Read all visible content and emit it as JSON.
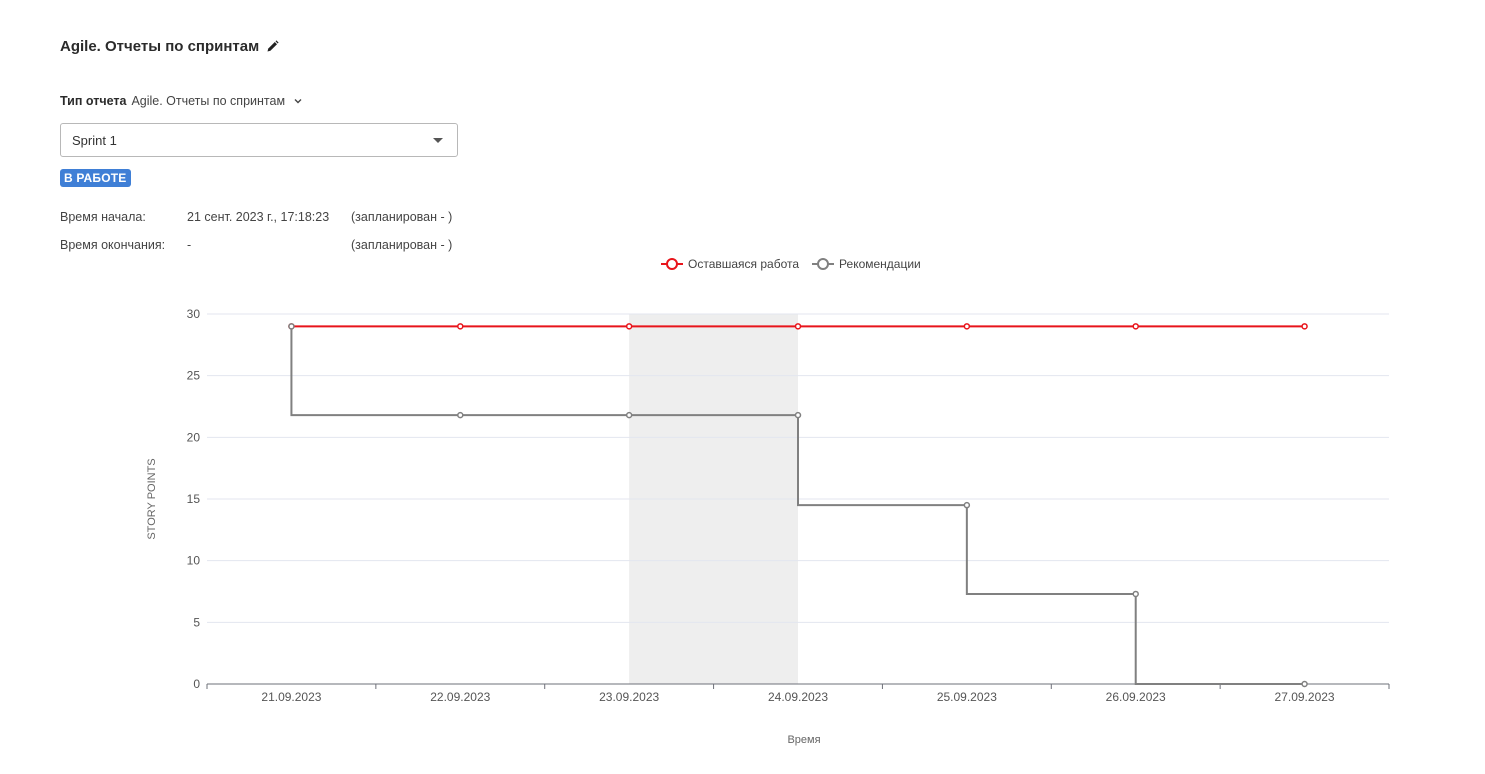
{
  "header": {
    "title": "Agile. Отчеты по спринтам"
  },
  "report_type": {
    "label": "Тип отчета",
    "value": "Agile. Отчеты по спринтам"
  },
  "sprint_select": {
    "value": "Sprint 1"
  },
  "status_badge": "В РАБОТЕ",
  "timing": {
    "start_label": "Время начала:",
    "start_value": "21 сент. 2023 г., 17:18:23",
    "start_planned": "(запланирован - )",
    "end_label": "Время окончания:",
    "end_value": "-",
    "end_planned": "(запланирован - )"
  },
  "colors": {
    "remaining": "#e8141b",
    "recommend": "#808080",
    "weekend_band": "#eeeeee",
    "badge": "#3f7fd6"
  },
  "chart_data": {
    "type": "line",
    "xlabel": "Время",
    "ylabel": "STORY POINTS",
    "ylim": [
      0,
      30
    ],
    "yticks": [
      0,
      5,
      10,
      15,
      20,
      25,
      30
    ],
    "categories": [
      "21.09.2023",
      "22.09.2023",
      "23.09.2023",
      "24.09.2023",
      "25.09.2023",
      "26.09.2023",
      "27.09.2023"
    ],
    "highlight_band": [
      "23.09.2023",
      "24.09.2023"
    ],
    "grid": true,
    "legend_position": "top-center",
    "series": [
      {
        "name": "Оставшаяся работа",
        "step": false,
        "values": [
          29,
          29,
          29,
          29,
          29,
          29,
          29
        ]
      },
      {
        "name": "Рекомендации",
        "step": true,
        "values": [
          29,
          21.8,
          21.8,
          21.8,
          14.5,
          7.3,
          0
        ]
      }
    ]
  }
}
